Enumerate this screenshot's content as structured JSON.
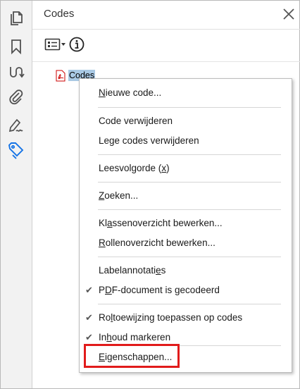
{
  "panel": {
    "title": "Codes",
    "root_label": "Codes"
  },
  "sidebar": {
    "items": [
      {
        "icon": "pages-icon"
      },
      {
        "icon": "bookmark-icon"
      },
      {
        "icon": "content-order-icon"
      },
      {
        "icon": "attachment-icon"
      },
      {
        "icon": "signature-icon"
      },
      {
        "icon": "tags-icon",
        "active": true
      }
    ]
  },
  "menu": {
    "items": {
      "new_code": {
        "pre": "",
        "u": "N",
        "post": "ieuwe code..."
      },
      "delete_code": {
        "text": "Code verwijderen"
      },
      "delete_empty": {
        "pre": "Le",
        "u": "g",
        "post": "e codes verwijderen"
      },
      "reading_order": {
        "pre": "Leesvolgorde (",
        "u": "x",
        "post": ")"
      },
      "find": {
        "pre": "",
        "u": "Z",
        "post": "oeken..."
      },
      "class_map": {
        "pre": "Kl",
        "u": "a",
        "post": "ssenoverzicht bewerken..."
      },
      "role_map": {
        "pre": "",
        "u": "R",
        "post": "ollenoverzicht bewerken..."
      },
      "tag_annotations": {
        "pre": "Labelannotati",
        "u": "e",
        "post": "s"
      },
      "pdf_tagged": {
        "pre": "P",
        "u": "D",
        "post": "F-document is gecodeerd",
        "checked": true
      },
      "apply_role": {
        "pre": "Ro",
        "u": "l",
        "post": "toewijzing toepassen op codes",
        "checked": true
      },
      "mark_content": {
        "pre": "In",
        "u": "h",
        "post": "oud markeren",
        "checked": true
      },
      "properties": {
        "pre": "",
        "u": "E",
        "post": "igenschappen..."
      }
    }
  },
  "colors": {
    "active_icon": "#1473e6",
    "highlight_border": "#e11b1b",
    "selection": "#a9c9e4"
  }
}
